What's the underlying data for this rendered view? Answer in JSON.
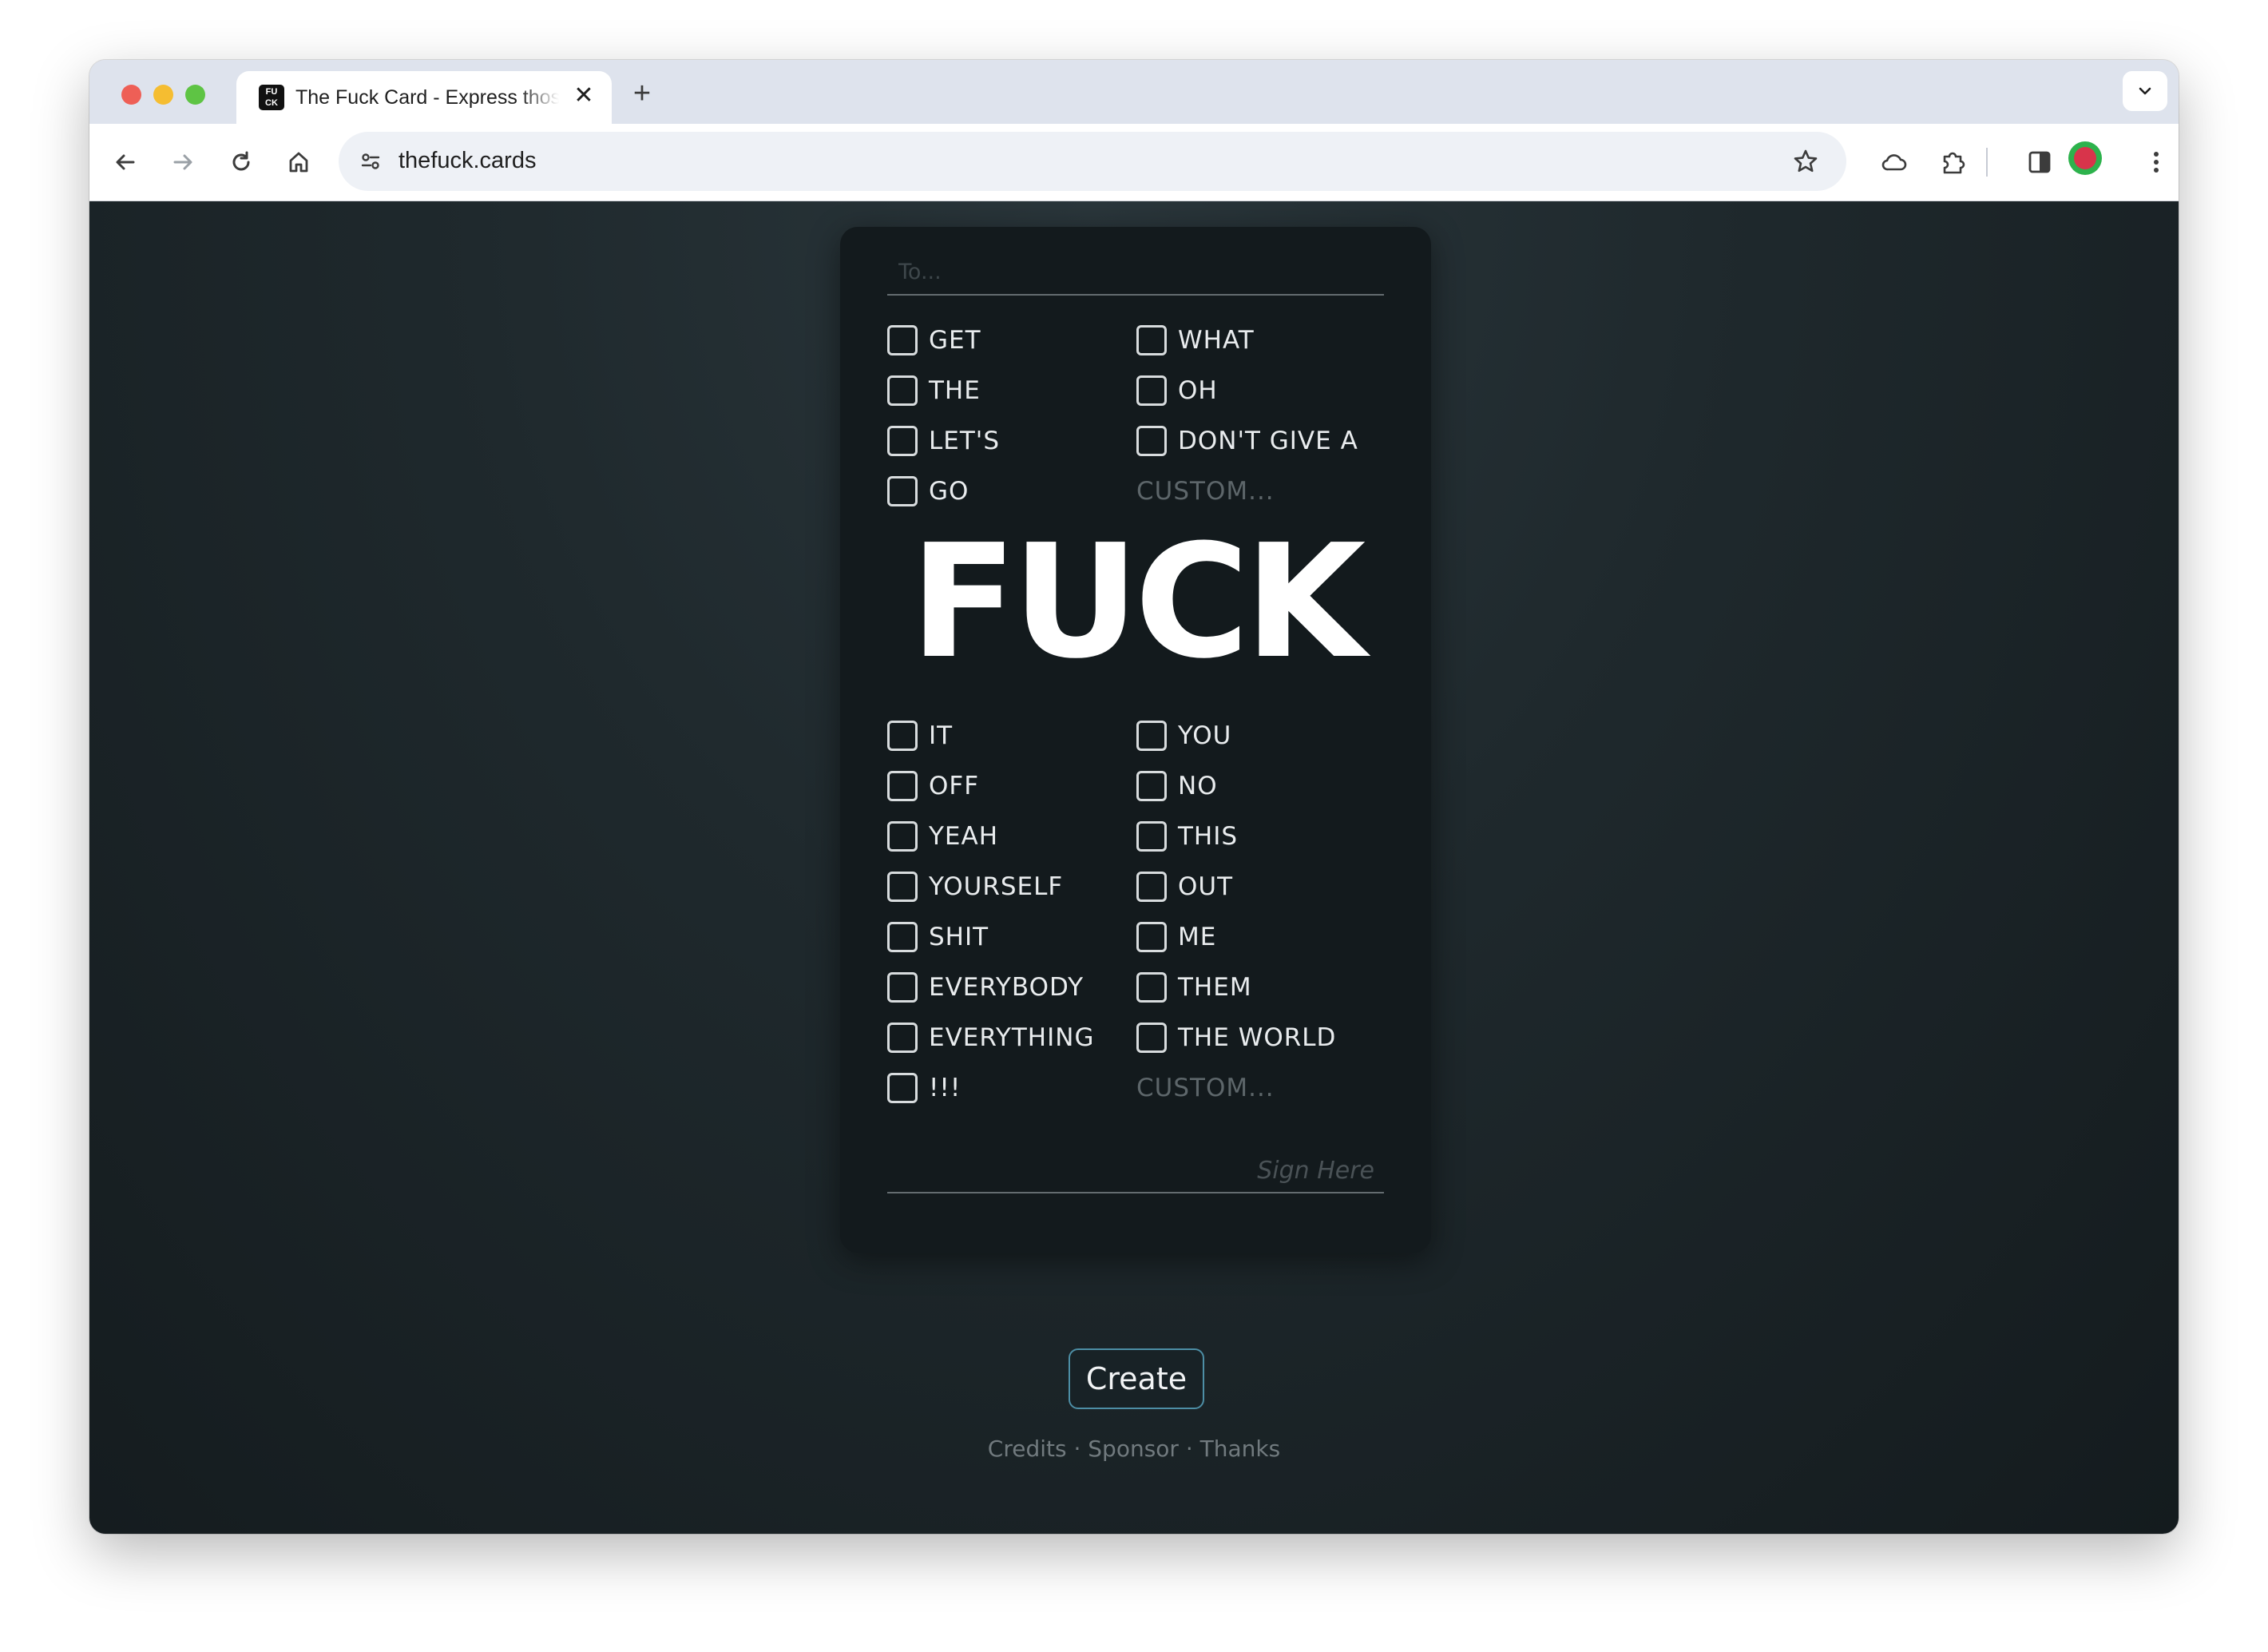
{
  "browser": {
    "tab_title": "The Fuck Card - Express those feelings",
    "favicon_text": "FU CK",
    "close_glyph": "✕",
    "new_tab_glyph": "+",
    "url": "thefuck.cards"
  },
  "card": {
    "to_placeholder": "To...",
    "top_left": [
      "GET",
      "THE",
      "LET'S",
      "GO"
    ],
    "top_right": [
      "WHAT",
      "OH",
      "DON'T GIVE A"
    ],
    "top_custom_placeholder": "CUSTOM...",
    "big_word": "FUCK",
    "bottom_left": [
      "IT",
      "OFF",
      "YEAH",
      "YOURSELF",
      "SHIT",
      "EVERYBODY",
      "EVERYTHING",
      "!!!"
    ],
    "bottom_right": [
      "YOU",
      "NO",
      "THIS",
      "OUT",
      "ME",
      "THEM",
      "THE WORLD"
    ],
    "bottom_custom_placeholder": "CUSTOM...",
    "sign_placeholder": "Sign Here"
  },
  "create_label": "Create",
  "footer": {
    "credits": "Credits",
    "sponsor": "Sponsor",
    "thanks": "Thanks",
    "separator": "·"
  },
  "colors": {
    "page_bg": "#1c2529",
    "card_bg": "#131a1d",
    "button_border": "#4d8ea5"
  }
}
